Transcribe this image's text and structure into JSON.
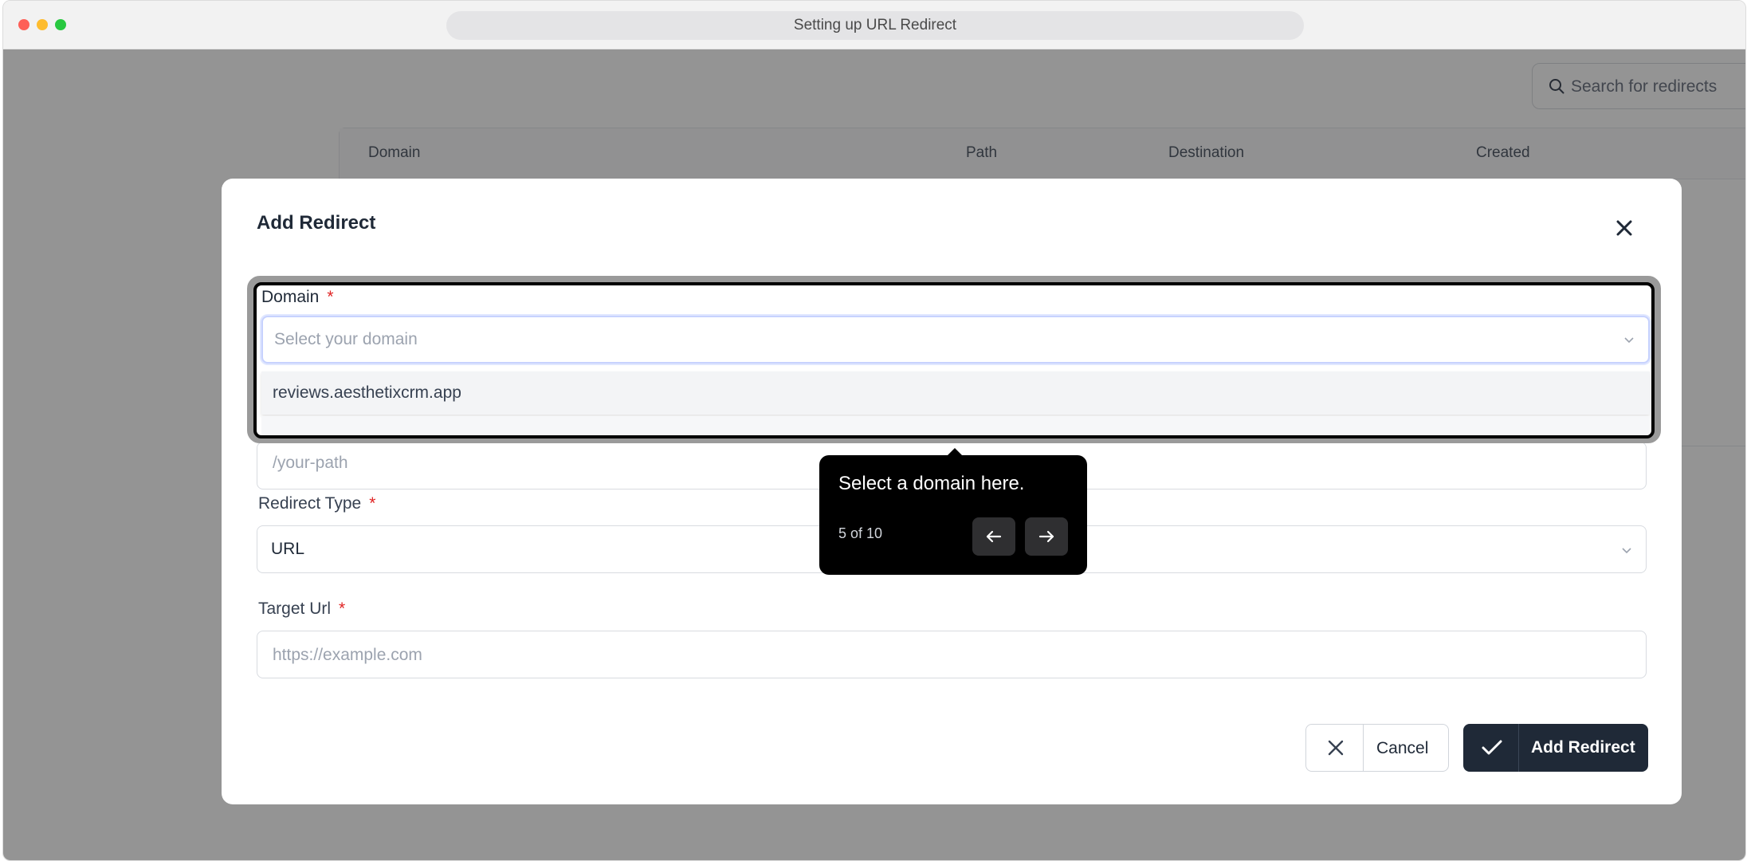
{
  "window": {
    "title": "Setting up URL Redirect"
  },
  "background": {
    "search_placeholder": "Search for redirects",
    "table_headers": [
      "Domain",
      "Path",
      "Destination",
      "Created"
    ]
  },
  "modal": {
    "title": "Add Redirect",
    "domain": {
      "label": "Domain",
      "required": "*",
      "placeholder": "Select your domain",
      "option": "reviews.aesthetixcrm.app"
    },
    "path": {
      "placeholder": "/your-path"
    },
    "redirect_type": {
      "label": "Redirect Type",
      "required": "*",
      "value": "URL"
    },
    "target_url": {
      "label": "Target Url",
      "required": "*",
      "placeholder": "https://example.com"
    },
    "cancel_label": "Cancel",
    "add_label": "Add Redirect"
  },
  "tooltip": {
    "text": "Select a domain here.",
    "step": "5 of 10"
  },
  "colors": {
    "primary_button": "#1f2937",
    "required": "#e02424",
    "tooltip_bg": "#000000"
  },
  "icons": [
    "search-icon",
    "close-icon",
    "chevron-down-icon",
    "x-icon",
    "check-icon",
    "arrow-left-icon",
    "arrow-right-icon"
  ]
}
